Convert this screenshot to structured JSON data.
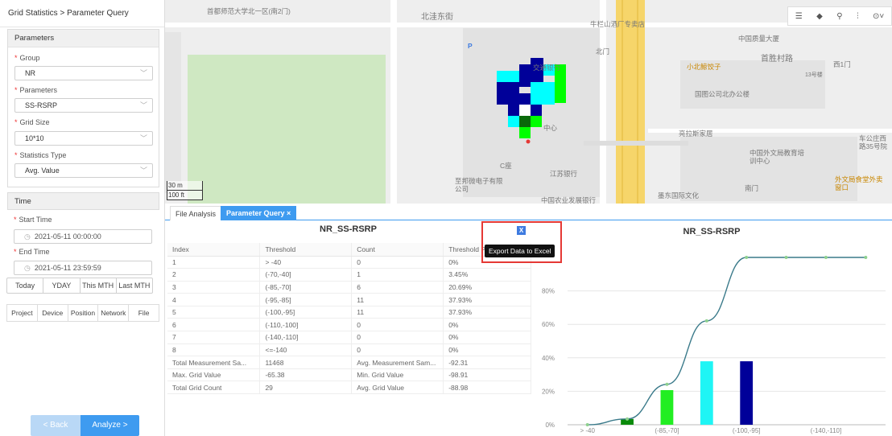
{
  "breadcrumb": "Grid Statistics > Parameter Query",
  "parameters": {
    "title": "Parameters",
    "group_label": "Group",
    "group_value": "NR",
    "param_label": "Parameters",
    "param_value": "SS-RSRP",
    "grid_label": "Grid Size",
    "grid_value": "10*10",
    "stat_label": "Statistics Type",
    "stat_value": "Avg. Value"
  },
  "time": {
    "title": "Time",
    "start_label": "Start Time",
    "start_value": "2021-05-11 00:00:00",
    "end_label": "End Time",
    "end_value": "2021-05-11 23:59:59",
    "quick": [
      "Today",
      "YDAY",
      "This MTH",
      "Last MTH"
    ]
  },
  "subtabs": [
    "Project",
    "Device",
    "Position",
    "Network",
    "File"
  ],
  "buttons": {
    "back": "< Back",
    "analyze": "Analyze >"
  },
  "map": {
    "labels": [
      "首都师范大学北一区(南2门)",
      "北洼东街",
      "牛栏山酒厂专卖店",
      "中国质量大厦",
      "首胜村路",
      "西1门",
      "小北鲸饺子",
      "13号楼",
      "国图公司北办公楼",
      "亮拉斯家居",
      "中国外文局教育培训中心",
      "车公庄西路35号院",
      "交通银行",
      "中心",
      "C座",
      "江苏银行",
      "至邦微电子有限公司",
      "中国农业发展银行",
      "墨东国际文化",
      "南门",
      "外文局食堂外卖窗口",
      "北门",
      "P"
    ],
    "scale_top": "30 m",
    "scale_bottom": "100 ft"
  },
  "tabs": {
    "file_analysis": "File Analysis",
    "parameter_query": "Parameter Query ×"
  },
  "table": {
    "title": "NR_SS-RSRP",
    "headers": [
      "Index",
      "Threshold",
      "Count",
      "Threshold P"
    ],
    "rows": [
      [
        "1",
        "> -40",
        "0",
        "0%"
      ],
      [
        "2",
        "(-70,-40]",
        "1",
        "3.45%"
      ],
      [
        "3",
        "(-85,-70]",
        "6",
        "20.69%"
      ],
      [
        "4",
        "(-95,-85]",
        "11",
        "37.93%"
      ],
      [
        "5",
        "(-100,-95]",
        "11",
        "37.93%"
      ],
      [
        "6",
        "(-110,-100]",
        "0",
        "0%"
      ],
      [
        "7",
        "(-140,-110]",
        "0",
        "0%"
      ],
      [
        "8",
        "<=-140",
        "0",
        "0%"
      ],
      [
        "Total Measurement Sa...",
        "11468",
        "Avg. Measurement Sam...",
        "-92.31"
      ],
      [
        "Max. Grid Value",
        "-65.38",
        "Min. Grid Value",
        "-98.91"
      ],
      [
        "Total Grid Count",
        "29",
        "Avg. Grid Value",
        "-88.98"
      ]
    ]
  },
  "export": {
    "icon": "excel-export-icon",
    "tooltip": "Export Data to Excel"
  },
  "chart_data": {
    "type": "bar",
    "title": "NR_SS-RSRP",
    "categories": [
      "> -40",
      "(-70,-40]",
      "(-85,-70]",
      "(-95,-85]",
      "(-100,-95]",
      "(-110,-100]",
      "(-140,-110]",
      "<=-140"
    ],
    "x_tick_labels": [
      "> -40",
      "(-85,-70]",
      "(-100,-95]",
      "(-140,-110]"
    ],
    "series": [
      {
        "type": "bar",
        "values": [
          0,
          3.45,
          20.69,
          37.93,
          37.93,
          0,
          0,
          0
        ]
      },
      {
        "type": "line",
        "values": [
          0,
          3.45,
          24.14,
          62.07,
          100,
          100,
          100,
          100
        ]
      }
    ],
    "bar_colors": [
      "#1a7a1a",
      "#0a8a0a",
      "#22ee22",
      "#1ff5f5",
      "#000099",
      "#444444",
      "#444444",
      "#444444"
    ],
    "line_color": "#3a7a8a",
    "ylim": [
      0,
      100
    ],
    "y_ticks": [
      "0%",
      "20%",
      "40%",
      "60%",
      "80%"
    ],
    "grid": true
  }
}
